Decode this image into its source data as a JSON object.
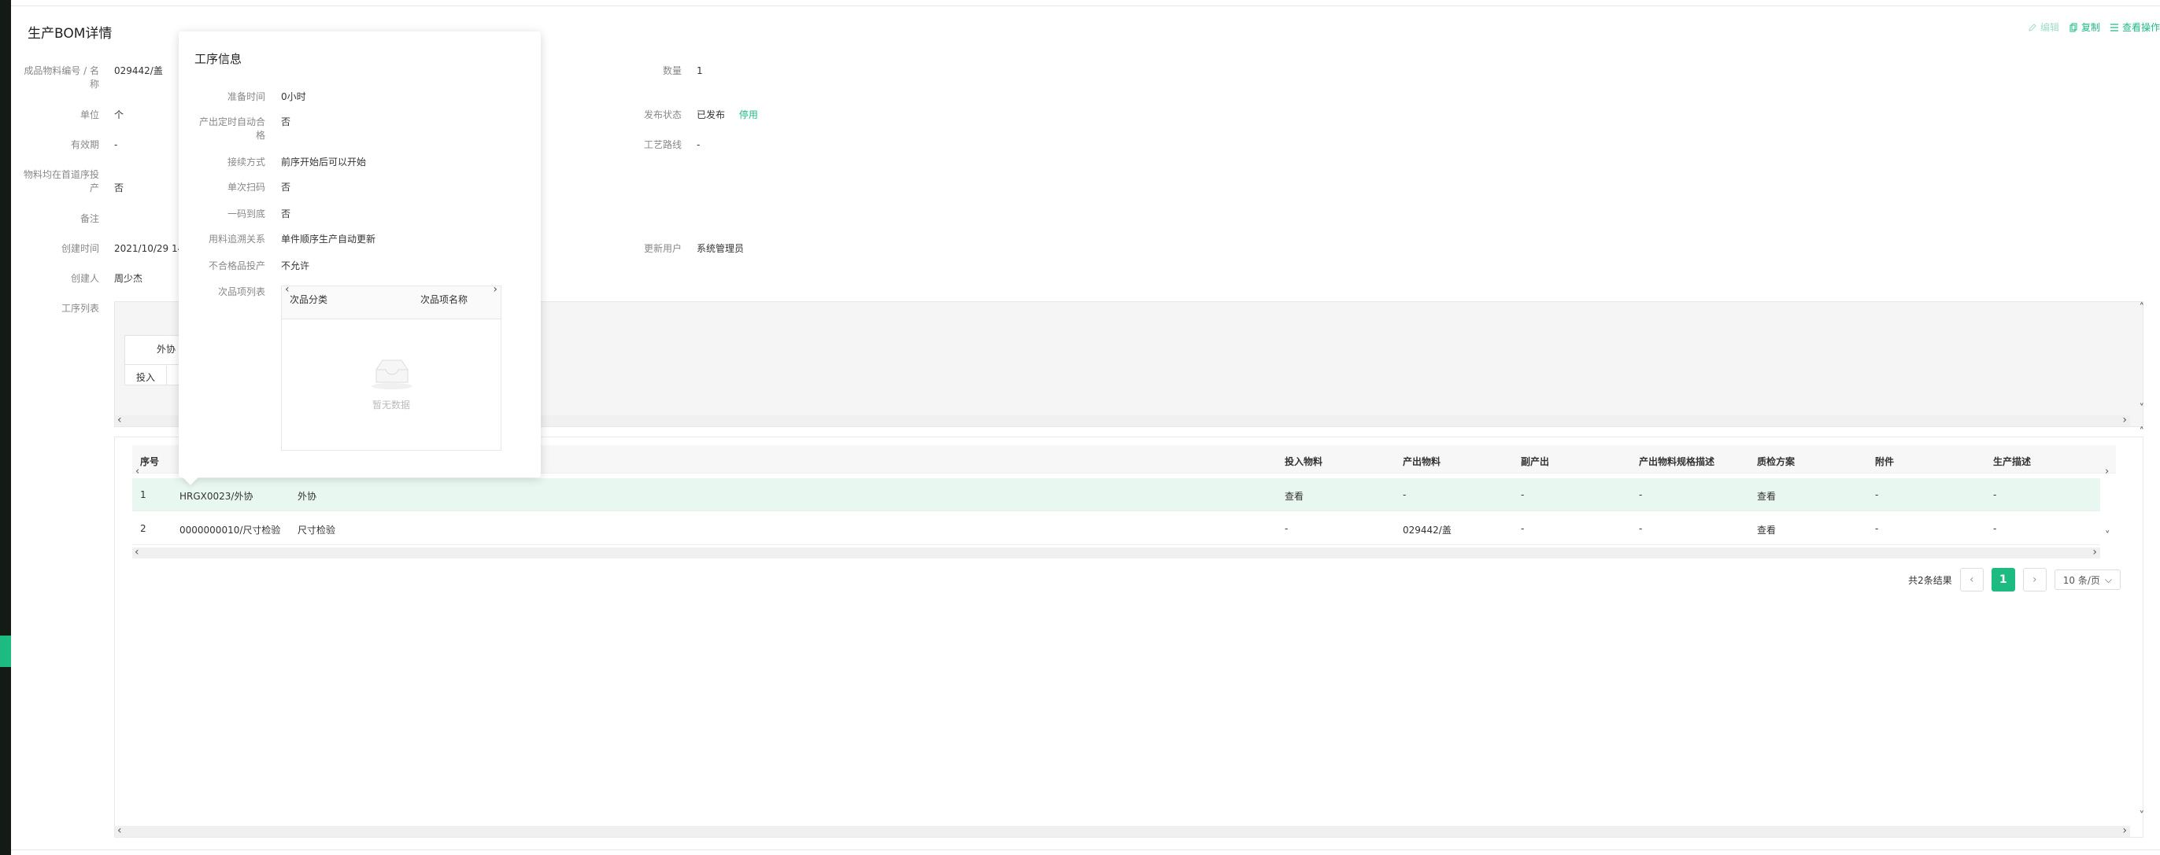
{
  "page": {
    "title": "生产BOM详情"
  },
  "actions": {
    "edit": "编辑",
    "copy": "复制",
    "view_ops": "查看操作"
  },
  "fields": {
    "material_label": "成品物料编号 / 名称",
    "material_value": "029442/盖",
    "quantity_label": "数量",
    "quantity_value": "1",
    "unit_label": "单位",
    "unit_value": "个",
    "publish_label": "发布状态",
    "publish_value": "已发布",
    "publish_action": "停用",
    "validity_label": "有效期",
    "validity_value": "-",
    "route_label": "工艺路线",
    "route_value": "-",
    "first_proc_label": "物料均在首道序投产",
    "first_proc_value": "否",
    "remark_label": "备注",
    "created_label": "创建时间",
    "created_value": "2021/10/29 14:5",
    "updater_label": "更新用户",
    "updater_value": "系统管理员",
    "creator_label": "创建人",
    "creator_value": "周少杰",
    "proc_list_label": "工序列表"
  },
  "upper_panel": {
    "tab_label": "外协",
    "input_label": "投入"
  },
  "table": {
    "headers": [
      "序号",
      "投入物料",
      "产出物料",
      "副产出",
      "产出物料规格描述",
      "质检方案",
      "附件",
      "生产描述"
    ],
    "rows": [
      {
        "index": "1",
        "code": "HRGX0023/外协",
        "name": "外协",
        "input": "查看",
        "output": "-",
        "byproduct": "-",
        "spec": "-",
        "qc": "查看",
        "attach": "-",
        "desc": "-"
      },
      {
        "index": "2",
        "code": "0000000010/尺寸检验",
        "name": "尺寸检验",
        "input": "-",
        "output": "029442/盖",
        "byproduct": "-",
        "spec": "-",
        "qc": "查看",
        "attach": "-",
        "desc": "-"
      }
    ]
  },
  "pagination": {
    "total": "共2条结果",
    "current": "1",
    "page_size": "10 条/页"
  },
  "popover": {
    "title": "工序信息",
    "prep_label": "准备时间",
    "prep_value": "0小时",
    "auto_label": "产出定时自动合格",
    "auto_value": "否",
    "handover_label": "接续方式",
    "handover_value": "前序开始后可以开始",
    "scan_label": "单次扫码",
    "scan_value": "否",
    "onecode_label": "一码到底",
    "onecode_value": "否",
    "usage_label": "用料追溯关系",
    "usage_value": "单件顺序生产自动更新",
    "defect_label": "不合格品投产",
    "defect_value": "不允许",
    "defect_list_label": "次品项列表",
    "inner_head_1": "次品分类",
    "inner_head_2": "次品项名称",
    "empty_text": "暂无数据"
  },
  "colors": {
    "accent": "#1dbb82",
    "sidebar": "#141a16"
  }
}
